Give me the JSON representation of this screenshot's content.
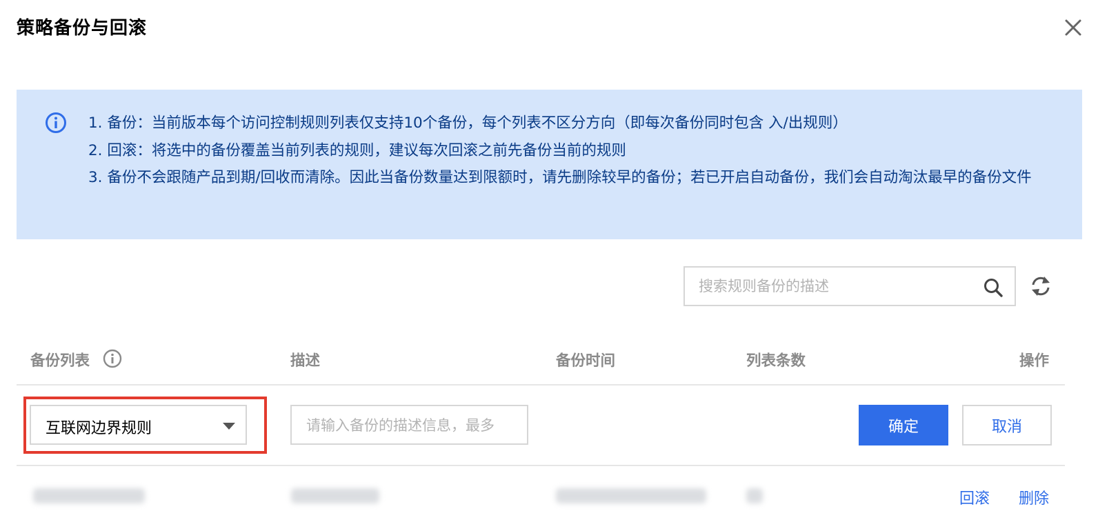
{
  "dialog": {
    "title": "策略备份与回滚"
  },
  "notice": {
    "lines": [
      "1. 备份：当前版本每个访问控制规则列表仅支持10个备份，每个列表不区分方向（即每次备份同时包含 入/出规则）",
      "2. 回滚：将选中的备份覆盖当前列表的规则，建议每次回滚之前先备份当前的规则",
      "3. 备份不会跟随产品到期/回收而清除。因此当备份数量达到限额时，请先删除较早的备份；若已开启自动备份，我们会自动淘汰最早的备份文件"
    ]
  },
  "search": {
    "placeholder": "搜索规则备份的描述"
  },
  "table": {
    "columns": {
      "list": "备份列表",
      "desc": "描述",
      "time": "备份时间",
      "count": "列表条数",
      "ops": "操作"
    }
  },
  "edit_row": {
    "selected_list": "互联网边界规则",
    "desc_placeholder": "请输入备份的描述信息，最多",
    "ok_label": "确定",
    "cancel_label": "取消"
  },
  "row": {
    "rollback_label": "回滚",
    "delete_label": "删除"
  },
  "colors": {
    "accent": "#2f6de8",
    "notice_bg": "#d5e5fb",
    "notice_text": "#0a3b86",
    "highlight": "#e33b2e"
  }
}
